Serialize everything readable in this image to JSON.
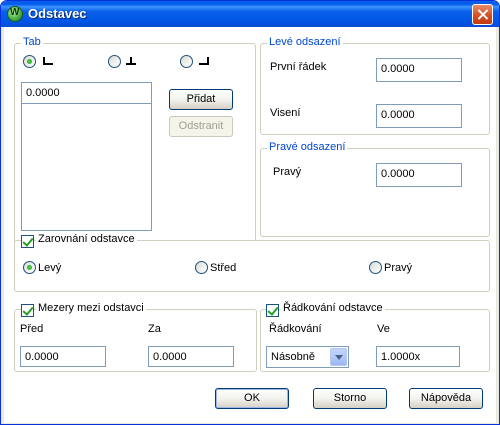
{
  "window": {
    "title": "Odstavec"
  },
  "tab": {
    "legend": "Tab",
    "value": "0.0000",
    "add_label": "Přidat",
    "remove_label": "Odstranit",
    "types": [
      "left-tab-icon",
      "center-tab-icon",
      "right-tab-icon"
    ],
    "selected_type": "left-tab-icon"
  },
  "left_indent": {
    "legend": "Levé odsazení",
    "first_line_label": "První řádek",
    "first_line_value": "0.0000",
    "hanging_label": "Visení",
    "hanging_value": "0.0000"
  },
  "right_indent": {
    "legend": "Pravé odsazení",
    "right_label": "Pravý",
    "right_value": "0.0000"
  },
  "alignment": {
    "label": "Zarovnání odstavce",
    "checked": true,
    "left_label": "Levý",
    "center_label": "Střed",
    "right_label": "Pravý",
    "selected": "Levý"
  },
  "spacing": {
    "label": "Mezery mezi odstavci",
    "checked": true,
    "before_label": "Před",
    "before_value": "0.0000",
    "after_label": "Za",
    "after_value": "0.0000"
  },
  "line_spacing": {
    "label": "Řádkování odstavce",
    "checked": true,
    "mode_label": "Řádkování",
    "mode_value": "Násobně",
    "at_label": "Ve",
    "at_value": "1.0000x"
  },
  "buttons": {
    "ok_label": "OK",
    "cancel_label": "Storno",
    "help_label": "Nápověda"
  },
  "colors": {
    "titlebar": "#0a5fe8",
    "legend_text": "#0046d5",
    "dialog_face": "#ece9d8"
  }
}
